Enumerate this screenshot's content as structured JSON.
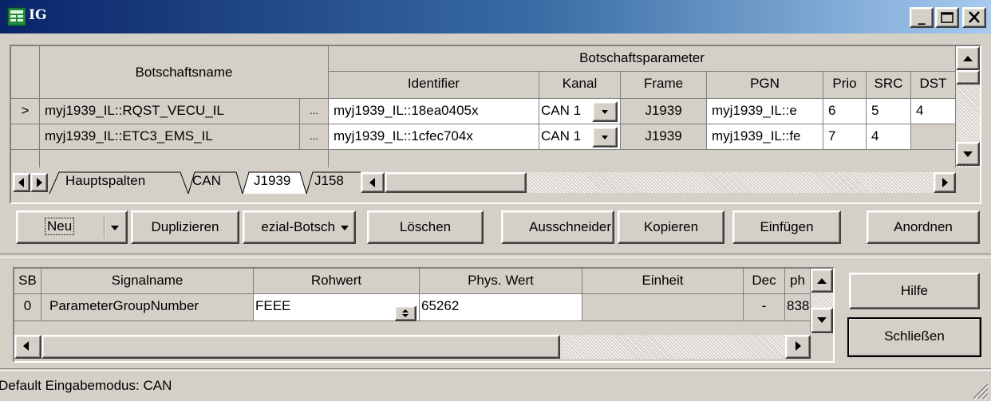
{
  "window": {
    "title": "IG"
  },
  "upper_grid": {
    "group_header": "Botschaftsparameter",
    "name_header": "Botschaftsname",
    "columns": [
      "Identifier",
      "Kanal",
      "Frame",
      "PGN",
      "Prio",
      "SRC",
      "DST"
    ],
    "rows": [
      {
        "indicator": ">",
        "name": "myj1939_IL::RQST_VECU_IL",
        "dots": "...",
        "identifier": "myj1939_IL::18ea0405x",
        "kanal": "CAN 1",
        "frame": "J1939",
        "pgn": "myj1939_IL::e",
        "prio": "6",
        "src": "5",
        "dst": "4"
      },
      {
        "indicator": "",
        "name": "myj1939_IL::ETC3_EMS_IL",
        "dots": "...",
        "identifier": "myj1939_IL::1cfec704x",
        "kanal": "CAN 1",
        "frame": "J1939",
        "pgn": "myj1939_IL::fe",
        "prio": "7",
        "src": "4",
        "dst": ""
      }
    ]
  },
  "tabs": [
    "Hauptspalten",
    "CAN",
    "J1939",
    "J158"
  ],
  "toolbar": {
    "neu": "Neu",
    "duplizieren": "Duplizieren",
    "spezial": "ezial-Botsch",
    "loeschen": "Löschen",
    "ausschneiden": "Ausschneider",
    "kopieren": "Kopieren",
    "einfuegen": "Einfügen",
    "anordnen": "Anordnen"
  },
  "signal_grid": {
    "columns": [
      "SB",
      "Signalname",
      "Rohwert",
      "Phys. Wert",
      "Einheit",
      "Dec",
      "ph"
    ],
    "rows": [
      {
        "sb": "0",
        "signalname": "ParameterGroupNumber",
        "rohwert": "FEEE",
        "phys": "65262",
        "einheit": "",
        "dec": "-",
        "ph": "838"
      }
    ]
  },
  "side_buttons": {
    "hilfe": "Hilfe",
    "schliessen": "Schließen"
  },
  "status": {
    "text": "Default Eingabemodus: CAN"
  }
}
